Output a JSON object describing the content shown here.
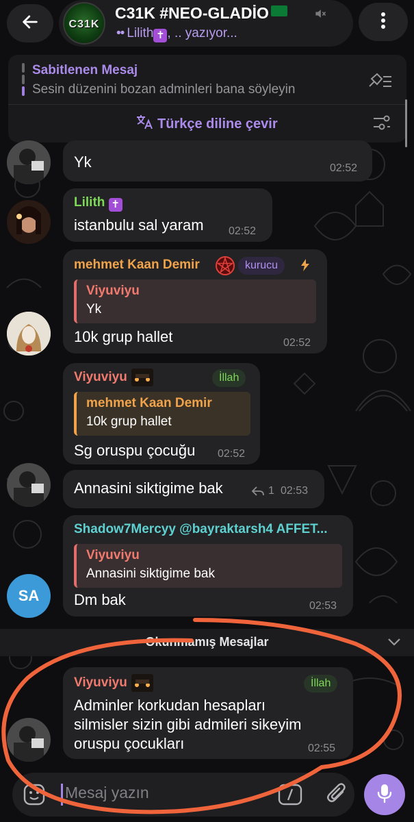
{
  "header": {
    "title": "C31K #NEO-GLADİO",
    "avatar_text": "C31K",
    "typing_name": "Lilith",
    "typing_suffix": ", .. yazıyor...",
    "typing_dots": "••"
  },
  "pinned": {
    "title": "Sabitlenen Mesaj",
    "text": "Sesin düzenini bozan adminleri bana söyleyin"
  },
  "translate": {
    "label": "Türkçe diline çevir"
  },
  "messages": [
    {
      "text": "Yk",
      "time": "02:52"
    },
    {
      "sender": "Lilith",
      "text": "istanbulu sal yaram",
      "time": "02:52"
    },
    {
      "sender": "mehmet Kaan Demir",
      "badge": "kurucu",
      "quote_name": "Viyuviyu",
      "quote_text": "Yk",
      "text": "10k grup hallet",
      "time": "02:52"
    },
    {
      "sender": "Viyuviyu",
      "badge": "İllah",
      "quote_name": "mehmet Kaan Demir",
      "quote_text": "10k grup hallet",
      "text": "Sg oruspu çocuğu",
      "time": "02:52"
    },
    {
      "text": "Annasini siktigime bak",
      "reply_count": "1",
      "time": "02:53"
    },
    {
      "sender": "Shadow7Mercyy @bayraktarsh4 AFFET...",
      "avatar_initials": "SA",
      "quote_name": "Viyuviyu",
      "quote_text": "Annasini siktigime bak",
      "text": "Dm bak",
      "time": "02:53"
    },
    {
      "sender": "Viyuviyu",
      "badge": "İllah",
      "lines": [
        "Adminler korkudan hesapları",
        "silmisler sizin gibi admileri sikeyim",
        "oruspu çocukları"
      ],
      "time": "02:55"
    }
  ],
  "unread_label": "Okunmamış Mesajlar",
  "input": {
    "placeholder": "Mesaj yazın"
  },
  "colors": {
    "accent": "#a585e6",
    "sender_green": "#7ed957",
    "sender_orange": "#f0a34a",
    "sender_red": "#f07a6e",
    "sender_teal": "#5fd0d0",
    "annotation": "#f0643c"
  }
}
